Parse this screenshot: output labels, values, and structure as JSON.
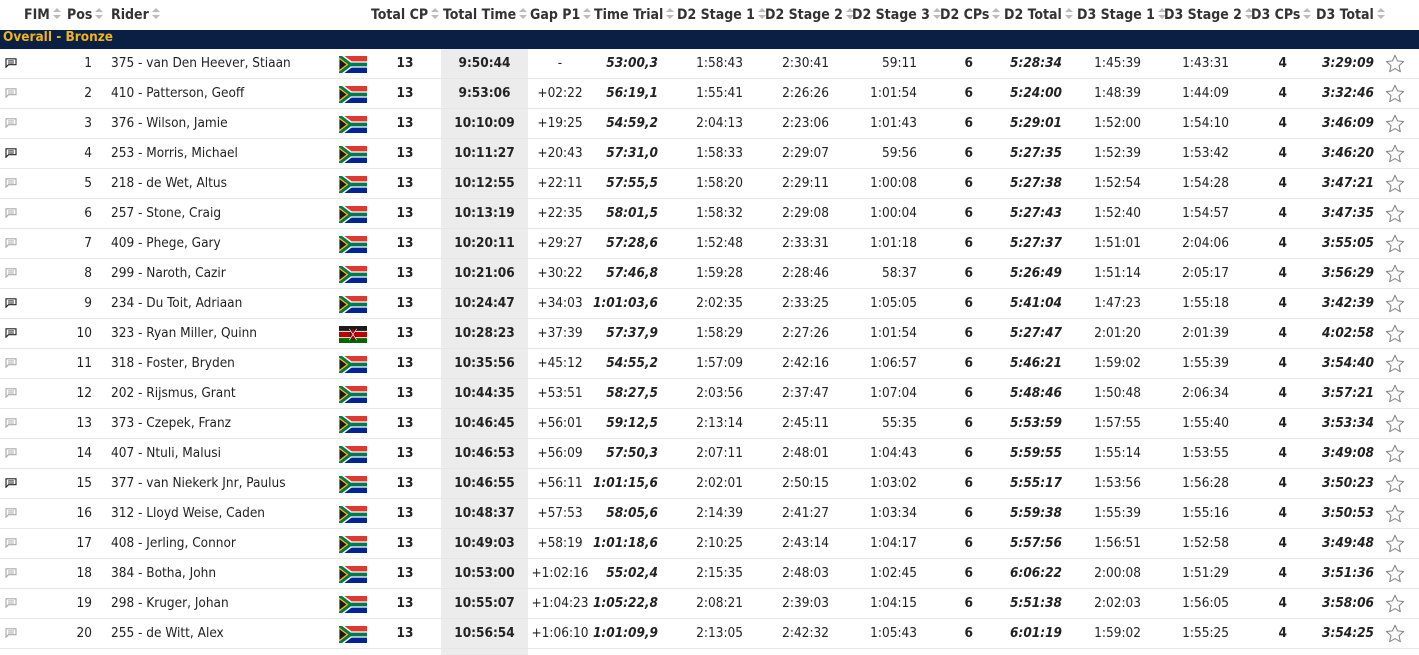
{
  "columns": [
    {
      "key": "fim",
      "label": "FIM"
    },
    {
      "key": "pos",
      "label": "Pos"
    },
    {
      "key": "rider",
      "label": "Rider"
    },
    {
      "key": "total_cp",
      "label": "Total CP"
    },
    {
      "key": "total_time",
      "label": "Total Time"
    },
    {
      "key": "gap_p1",
      "label": "Gap P1"
    },
    {
      "key": "time_trial",
      "label": "Time Trial"
    },
    {
      "key": "d2_stage1",
      "label": "D2 Stage 1"
    },
    {
      "key": "d2_stage2",
      "label": "D2 Stage 2"
    },
    {
      "key": "d2_stage3",
      "label": "D2 Stage 3"
    },
    {
      "key": "d2_cps",
      "label": "D2 CPs"
    },
    {
      "key": "d2_total",
      "label": "D2 Total"
    },
    {
      "key": "d3_stage1",
      "label": "D3 Stage 1"
    },
    {
      "key": "d3_stage2",
      "label": "D3 Stage 2"
    },
    {
      "key": "d3_cps",
      "label": "D3 CPs"
    },
    {
      "key": "d3_total",
      "label": "D3 Total"
    }
  ],
  "group_title": "Overall - Bronze",
  "icons": {
    "comment": "comment-icon",
    "favorite": "star-outline-icon",
    "sort": "sort-arrows-icon"
  },
  "colors": {
    "group_bg": "#0a1f44",
    "group_text": "#f0b41b",
    "band": "#ececec",
    "comment_dark": "#222222",
    "comment_light": "#aaaaaa"
  },
  "rows": [
    {
      "comment": "dark",
      "pos": "1",
      "rider": "375 - van Den Heever, Stiaan",
      "flag": "ZA",
      "total_cp": "13",
      "total_time": "9:50:44",
      "gap_p1": "-",
      "time_trial": "53:00,3",
      "d2_stage1": "1:58:43",
      "d2_stage2": "2:30:41",
      "d2_stage3": "59:11",
      "d2_cps": "6",
      "d2_total": "5:28:34",
      "d3_stage1": "1:45:39",
      "d3_stage2": "1:43:31",
      "d3_cps": "4",
      "d3_total": "3:29:09"
    },
    {
      "comment": "light",
      "pos": "2",
      "rider": "410 - Patterson, Geoff",
      "flag": "ZA",
      "total_cp": "13",
      "total_time": "9:53:06",
      "gap_p1": "+02:22",
      "time_trial": "56:19,1",
      "d2_stage1": "1:55:41",
      "d2_stage2": "2:26:26",
      "d2_stage3": "1:01:54",
      "d2_cps": "6",
      "d2_total": "5:24:00",
      "d3_stage1": "1:48:39",
      "d3_stage2": "1:44:09",
      "d3_cps": "4",
      "d3_total": "3:32:46"
    },
    {
      "comment": "light",
      "pos": "3",
      "rider": "376 - Wilson, Jamie",
      "flag": "ZA",
      "total_cp": "13",
      "total_time": "10:10:09",
      "gap_p1": "+19:25",
      "time_trial": "54:59,2",
      "d2_stage1": "2:04:13",
      "d2_stage2": "2:23:06",
      "d2_stage3": "1:01:43",
      "d2_cps": "6",
      "d2_total": "5:29:01",
      "d3_stage1": "1:52:00",
      "d3_stage2": "1:54:10",
      "d3_cps": "4",
      "d3_total": "3:46:09"
    },
    {
      "comment": "dark",
      "pos": "4",
      "rider": "253 - Morris, Michael",
      "flag": "ZA",
      "total_cp": "13",
      "total_time": "10:11:27",
      "gap_p1": "+20:43",
      "time_trial": "57:31,0",
      "d2_stage1": "1:58:33",
      "d2_stage2": "2:29:07",
      "d2_stage3": "59:56",
      "d2_cps": "6",
      "d2_total": "5:27:35",
      "d3_stage1": "1:52:39",
      "d3_stage2": "1:53:42",
      "d3_cps": "4",
      "d3_total": "3:46:20"
    },
    {
      "comment": "light",
      "pos": "5",
      "rider": "218 - de Wet, Altus",
      "flag": "ZA",
      "total_cp": "13",
      "total_time": "10:12:55",
      "gap_p1": "+22:11",
      "time_trial": "57:55,5",
      "d2_stage1": "1:58:20",
      "d2_stage2": "2:29:11",
      "d2_stage3": "1:00:08",
      "d2_cps": "6",
      "d2_total": "5:27:38",
      "d3_stage1": "1:52:54",
      "d3_stage2": "1:54:28",
      "d3_cps": "4",
      "d3_total": "3:47:21"
    },
    {
      "comment": "light",
      "pos": "6",
      "rider": "257 - Stone, Craig",
      "flag": "ZA",
      "total_cp": "13",
      "total_time": "10:13:19",
      "gap_p1": "+22:35",
      "time_trial": "58:01,5",
      "d2_stage1": "1:58:32",
      "d2_stage2": "2:29:08",
      "d2_stage3": "1:00:04",
      "d2_cps": "6",
      "d2_total": "5:27:43",
      "d3_stage1": "1:52:40",
      "d3_stage2": "1:54:57",
      "d3_cps": "4",
      "d3_total": "3:47:35"
    },
    {
      "comment": "light",
      "pos": "7",
      "rider": "409 - Phege, Gary",
      "flag": "ZA",
      "total_cp": "13",
      "total_time": "10:20:11",
      "gap_p1": "+29:27",
      "time_trial": "57:28,6",
      "d2_stage1": "1:52:48",
      "d2_stage2": "2:33:31",
      "d2_stage3": "1:01:18",
      "d2_cps": "6",
      "d2_total": "5:27:37",
      "d3_stage1": "1:51:01",
      "d3_stage2": "2:04:06",
      "d3_cps": "4",
      "d3_total": "3:55:05"
    },
    {
      "comment": "light",
      "pos": "8",
      "rider": "299 - Naroth, Cazir",
      "flag": "ZA",
      "total_cp": "13",
      "total_time": "10:21:06",
      "gap_p1": "+30:22",
      "time_trial": "57:46,8",
      "d2_stage1": "1:59:28",
      "d2_stage2": "2:28:46",
      "d2_stage3": "58:37",
      "d2_cps": "6",
      "d2_total": "5:26:49",
      "d3_stage1": "1:51:14",
      "d3_stage2": "2:05:17",
      "d3_cps": "4",
      "d3_total": "3:56:29"
    },
    {
      "comment": "dark",
      "pos": "9",
      "rider": "234 - Du Toit, Adriaan",
      "flag": "ZA",
      "total_cp": "13",
      "total_time": "10:24:47",
      "gap_p1": "+34:03",
      "time_trial": "1:01:03,6",
      "d2_stage1": "2:02:35",
      "d2_stage2": "2:33:25",
      "d2_stage3": "1:05:05",
      "d2_cps": "6",
      "d2_total": "5:41:04",
      "d3_stage1": "1:47:23",
      "d3_stage2": "1:55:18",
      "d3_cps": "4",
      "d3_total": "3:42:39"
    },
    {
      "comment": "dark",
      "pos": "10",
      "rider": "323 - Ryan Miller, Quinn",
      "flag": "KE",
      "total_cp": "13",
      "total_time": "10:28:23",
      "gap_p1": "+37:39",
      "time_trial": "57:37,9",
      "d2_stage1": "1:58:29",
      "d2_stage2": "2:27:26",
      "d2_stage3": "1:01:54",
      "d2_cps": "6",
      "d2_total": "5:27:47",
      "d3_stage1": "2:01:20",
      "d3_stage2": "2:01:39",
      "d3_cps": "4",
      "d3_total": "4:02:58"
    },
    {
      "comment": "light",
      "pos": "11",
      "rider": "318 - Foster, Bryden",
      "flag": "ZA",
      "total_cp": "13",
      "total_time": "10:35:56",
      "gap_p1": "+45:12",
      "time_trial": "54:55,2",
      "d2_stage1": "1:57:09",
      "d2_stage2": "2:42:16",
      "d2_stage3": "1:06:57",
      "d2_cps": "6",
      "d2_total": "5:46:21",
      "d3_stage1": "1:59:02",
      "d3_stage2": "1:55:39",
      "d3_cps": "4",
      "d3_total": "3:54:40"
    },
    {
      "comment": "light",
      "pos": "12",
      "rider": "202 - Rijsmus, Grant",
      "flag": "ZA",
      "total_cp": "13",
      "total_time": "10:44:35",
      "gap_p1": "+53:51",
      "time_trial": "58:27,5",
      "d2_stage1": "2:03:56",
      "d2_stage2": "2:37:47",
      "d2_stage3": "1:07:04",
      "d2_cps": "6",
      "d2_total": "5:48:46",
      "d3_stage1": "1:50:48",
      "d3_stage2": "2:06:34",
      "d3_cps": "4",
      "d3_total": "3:57:21"
    },
    {
      "comment": "light",
      "pos": "13",
      "rider": "373 - Czepek, Franz",
      "flag": "ZA",
      "total_cp": "13",
      "total_time": "10:46:45",
      "gap_p1": "+56:01",
      "time_trial": "59:12,5",
      "d2_stage1": "2:13:14",
      "d2_stage2": "2:45:11",
      "d2_stage3": "55:35",
      "d2_cps": "6",
      "d2_total": "5:53:59",
      "d3_stage1": "1:57:55",
      "d3_stage2": "1:55:40",
      "d3_cps": "4",
      "d3_total": "3:53:34"
    },
    {
      "comment": "light",
      "pos": "14",
      "rider": "407 - Ntuli, Malusi",
      "flag": "ZA",
      "total_cp": "13",
      "total_time": "10:46:53",
      "gap_p1": "+56:09",
      "time_trial": "57:50,3",
      "d2_stage1": "2:07:11",
      "d2_stage2": "2:48:01",
      "d2_stage3": "1:04:43",
      "d2_cps": "6",
      "d2_total": "5:59:55",
      "d3_stage1": "1:55:14",
      "d3_stage2": "1:53:55",
      "d3_cps": "4",
      "d3_total": "3:49:08"
    },
    {
      "comment": "dark",
      "pos": "15",
      "rider": "377 - van Niekerk Jnr, Paulus",
      "flag": "ZA",
      "total_cp": "13",
      "total_time": "10:46:55",
      "gap_p1": "+56:11",
      "time_trial": "1:01:15,6",
      "d2_stage1": "2:02:01",
      "d2_stage2": "2:50:15",
      "d2_stage3": "1:03:02",
      "d2_cps": "6",
      "d2_total": "5:55:17",
      "d3_stage1": "1:53:56",
      "d3_stage2": "1:56:28",
      "d3_cps": "4",
      "d3_total": "3:50:23"
    },
    {
      "comment": "light",
      "pos": "16",
      "rider": "312 - Lloyd Weise, Caden",
      "flag": "ZA",
      "total_cp": "13",
      "total_time": "10:48:37",
      "gap_p1": "+57:53",
      "time_trial": "58:05,6",
      "d2_stage1": "2:14:39",
      "d2_stage2": "2:41:27",
      "d2_stage3": "1:03:34",
      "d2_cps": "6",
      "d2_total": "5:59:38",
      "d3_stage1": "1:55:39",
      "d3_stage2": "1:55:16",
      "d3_cps": "4",
      "d3_total": "3:50:53"
    },
    {
      "comment": "light",
      "pos": "17",
      "rider": "408 - Jerling, Connor",
      "flag": "ZA",
      "total_cp": "13",
      "total_time": "10:49:03",
      "gap_p1": "+58:19",
      "time_trial": "1:01:18,6",
      "d2_stage1": "2:10:25",
      "d2_stage2": "2:43:14",
      "d2_stage3": "1:04:17",
      "d2_cps": "6",
      "d2_total": "5:57:56",
      "d3_stage1": "1:56:51",
      "d3_stage2": "1:52:58",
      "d3_cps": "4",
      "d3_total": "3:49:48"
    },
    {
      "comment": "light",
      "pos": "18",
      "rider": "384 - Botha, John",
      "flag": "ZA",
      "total_cp": "13",
      "total_time": "10:53:00",
      "gap_p1": "+1:02:16",
      "time_trial": "55:02,4",
      "d2_stage1": "2:15:35",
      "d2_stage2": "2:48:03",
      "d2_stage3": "1:02:45",
      "d2_cps": "6",
      "d2_total": "6:06:22",
      "d3_stage1": "2:00:08",
      "d3_stage2": "1:51:29",
      "d3_cps": "4",
      "d3_total": "3:51:36"
    },
    {
      "comment": "light",
      "pos": "19",
      "rider": "298 - Kruger, Johan",
      "flag": "ZA",
      "total_cp": "13",
      "total_time": "10:55:07",
      "gap_p1": "+1:04:23",
      "time_trial": "1:05:22,8",
      "d2_stage1": "2:08:21",
      "d2_stage2": "2:39:03",
      "d2_stage3": "1:04:15",
      "d2_cps": "6",
      "d2_total": "5:51:38",
      "d3_stage1": "2:02:03",
      "d3_stage2": "1:56:05",
      "d3_cps": "4",
      "d3_total": "3:58:06"
    },
    {
      "comment": "light",
      "pos": "20",
      "rider": "255 - de Witt, Alex",
      "flag": "ZA",
      "total_cp": "13",
      "total_time": "10:56:54",
      "gap_p1": "+1:06:10",
      "time_trial": "1:01:09,9",
      "d2_stage1": "2:13:05",
      "d2_stage2": "2:42:32",
      "d2_stage3": "1:05:43",
      "d2_cps": "6",
      "d2_total": "6:01:19",
      "d3_stage1": "1:59:02",
      "d3_stage2": "1:55:25",
      "d3_cps": "4",
      "d3_total": "3:54:25"
    }
  ]
}
